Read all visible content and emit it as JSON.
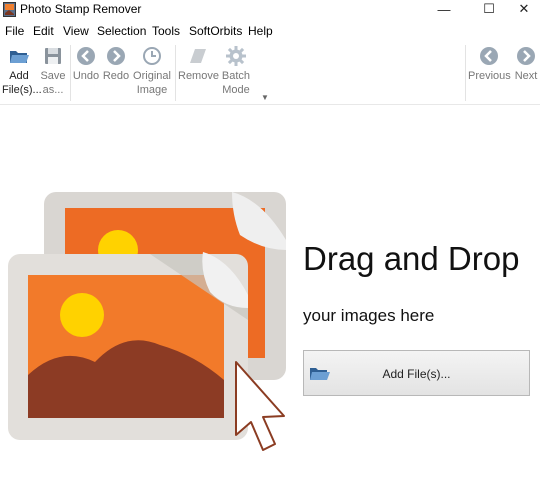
{
  "window": {
    "title": "Photo Stamp Remover",
    "minimize": "—",
    "maximize": "☐",
    "close": "✕"
  },
  "menu": [
    "File",
    "Edit",
    "View",
    "Selection",
    "Tools",
    "SoftOrbits",
    "Help"
  ],
  "toolbar": {
    "add_files": [
      "Add",
      "File(s)..."
    ],
    "save_as": [
      "Save",
      "as..."
    ],
    "undo": "Undo",
    "redo": "Redo",
    "original_image": [
      "Original",
      "Image"
    ],
    "remove": "Remove",
    "batch_mode": [
      "Batch",
      "Mode"
    ],
    "previous": "Previous",
    "next": "Next"
  },
  "main": {
    "heading": "Drag and Drop",
    "subheading": "your images here",
    "add_files_button": "Add File(s)..."
  },
  "colors": {
    "accent_orange": "#f27a2a",
    "sun": "#ffd200",
    "mountain": "#8c3b24",
    "frame": "#e0ddd9"
  }
}
